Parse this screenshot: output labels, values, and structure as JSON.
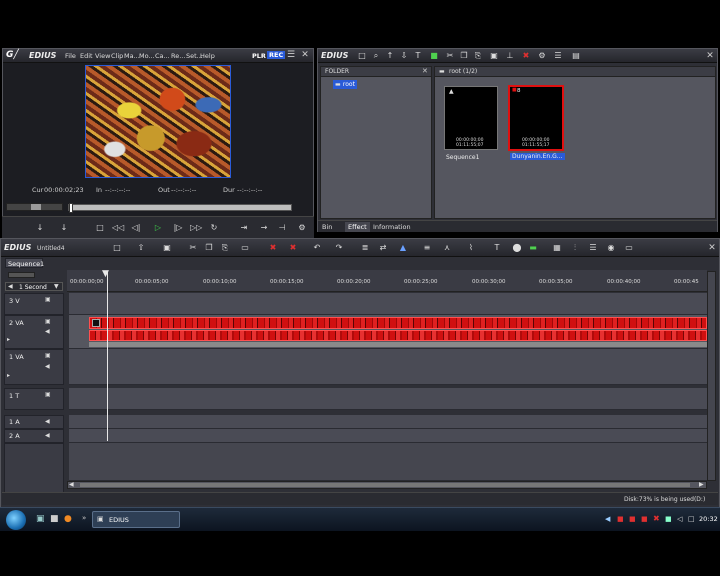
{
  "player": {
    "logo": "EDIUS",
    "menu": [
      "File",
      "Edit",
      "View",
      "Clip",
      "Ma...",
      "Mo...",
      "Ca...",
      "Re...",
      "Set...",
      "Help"
    ],
    "mode_plr": "PLR",
    "mode_rec": "REC",
    "cur_label": "Cur",
    "cur_value": "00:00:02;23",
    "in_label": "In",
    "in_value": "--:--:--:--",
    "out_label": "Out",
    "out_value": "--:--:--:--",
    "dur_label": "Dur",
    "dur_value": "--:--:--:--"
  },
  "bin": {
    "logo": "EDIUS",
    "folder_header": "FOLDER",
    "root_label": "root",
    "path_label": "root (1/2)",
    "items": [
      {
        "name": "Sequence1",
        "tc_top": "00:00:00;00",
        "tc_bottom": "01:11:55;07"
      },
      {
        "name": "Dunyanin.En.G...",
        "tc_top": "00:00:00;00",
        "tc_bottom": "01:11:55;17",
        "badge": "8"
      }
    ],
    "tabs": [
      "Bin",
      "Effect",
      "Information"
    ]
  },
  "timeline": {
    "logo": "EDIUS",
    "project_name": "Untitled4",
    "sequence_tab": "Sequence1",
    "scale_label": "1 Second",
    "ruler": [
      "00:00:00;00",
      "00:00:05;00",
      "00:00:10;00",
      "00:00:15;00",
      "00:00:20;00",
      "00:00:25;00",
      "00:00:30;00",
      "00:00:35;00",
      "00:00:40;00",
      "00:00:45"
    ],
    "tracks": [
      "3 V",
      "2 VA",
      "1 VA",
      "1 T",
      "1 A",
      "2 A"
    ],
    "status_text": "Disk:73% is being used(D:)"
  },
  "taskbar": {
    "task_label": "EDIUS",
    "clock": "20:32"
  },
  "colors": {
    "clip_red": "#d01010",
    "rec_blue": "#2a5bd8",
    "panel_bg": "#2e2f36",
    "lane_bg": "#4a4b55"
  }
}
